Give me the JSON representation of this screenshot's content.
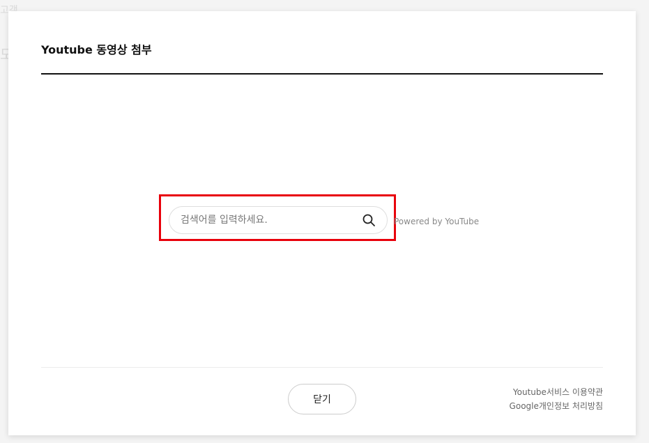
{
  "backdrop": {
    "text_1": "고객",
    "text_2": "모"
  },
  "modal": {
    "title": "Youtube 동영상 첨부"
  },
  "search": {
    "placeholder": "검색어를 입력하세요.",
    "value": "",
    "button_icon": "search-icon",
    "powered_by": "Powered by YouTube"
  },
  "footer": {
    "close_label": "닫기",
    "links": [
      "Youtube서비스 이용약관",
      "Google개인정보 처리방침"
    ]
  },
  "colors": {
    "highlight": "#e8000b",
    "title_rule": "#111111",
    "muted_text": "#888888"
  }
}
